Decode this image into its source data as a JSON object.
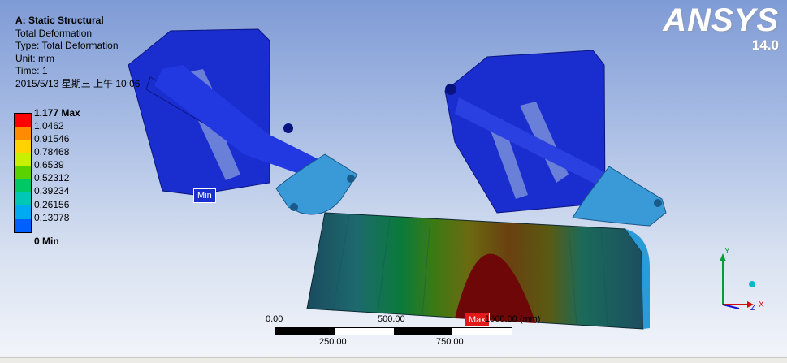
{
  "header": {
    "title": "A: Static Structural",
    "line2": "Total Deformation",
    "type": "Type: Total Deformation",
    "unit": "Unit: mm",
    "time": "Time: 1",
    "date": "2015/5/13 星期三 上午 10:06"
  },
  "legend": {
    "labels": [
      "1.177 Max",
      "1.0462",
      "0.91546",
      "0.78468",
      "0.6539",
      "0.52312",
      "0.39234",
      "0.26156",
      "0.13078",
      "0 Min"
    ],
    "colors": [
      "#ff0000",
      "#ff8c00",
      "#ffd200",
      "#c8f000",
      "#5ad200",
      "#00c864",
      "#00c8b4",
      "#00aaf0",
      "#0060ff",
      "#0000ff"
    ]
  },
  "logo": {
    "brand": "ANSYS",
    "version": "14.0"
  },
  "probes": {
    "min": "Min",
    "max": "Max"
  },
  "scale": {
    "ticks_top": [
      "0.00",
      "500.00",
      "1000.00 (mm)"
    ],
    "ticks_bottom": [
      "250.00",
      "750.00"
    ]
  },
  "triad": {
    "y": "Y",
    "x": "X",
    "z": "Z"
  }
}
